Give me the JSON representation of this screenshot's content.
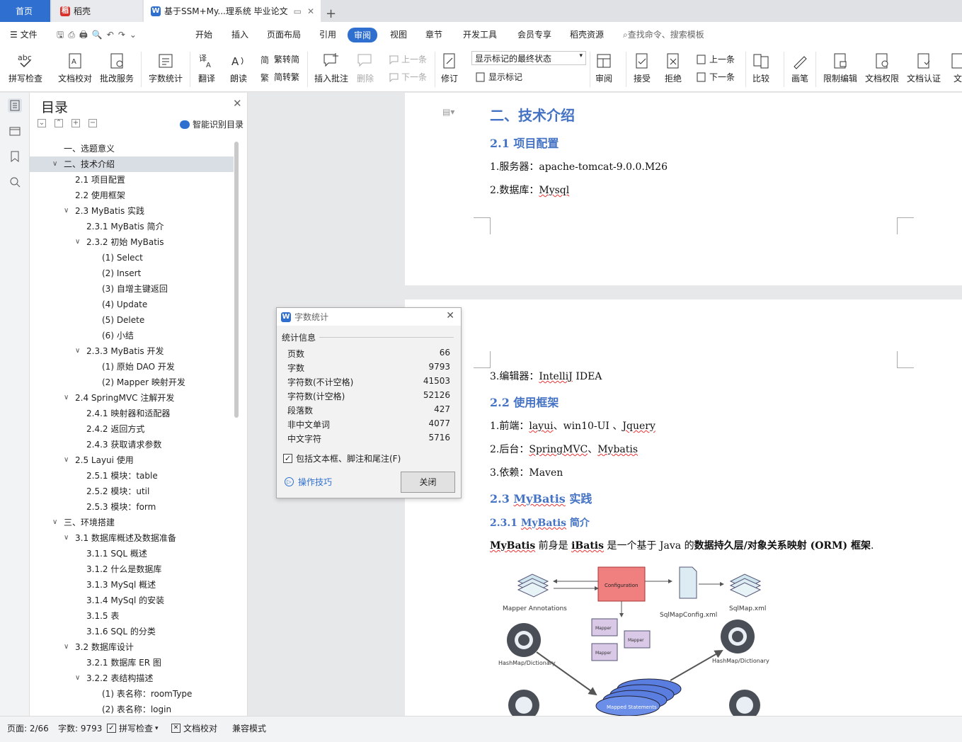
{
  "tabs": {
    "home": "首页",
    "daoke": "稻壳",
    "doc": "基于SSM+My...理系统 毕业论文"
  },
  "menu": {
    "file": "文件",
    "start": "开始",
    "insert": "插入",
    "layout": "页面布局",
    "reference": "引用",
    "review": "审阅",
    "view": "视图",
    "chapter": "章节",
    "dev": "开发工具",
    "member": "会员专享",
    "daoke_res": "稻壳资源",
    "search": "查找命令、搜索模板"
  },
  "ribbon": {
    "spell": "拼写检查",
    "proof": "文档校对",
    "correct": "批改服务",
    "wordcount": "字数统计",
    "translate": "翻译",
    "read": "朗读",
    "to_trad": "繁转简",
    "to_simp": "简转繁",
    "add_comment": "插入批注",
    "delete": "删除",
    "prev": "上一条",
    "next": "下一条",
    "track": "修订",
    "markup_state": "显示标记的最终状态",
    "show_markup": "显示标记",
    "review_pane": "审阅",
    "accept": "接受",
    "reject": "拒绝",
    "prev2": "上一条",
    "next2": "下一条",
    "compare": "比较",
    "pen": "画笔",
    "restrict": "限制编辑",
    "perm": "文档权限",
    "cert": "文档认证",
    "more": "文"
  },
  "toc": {
    "title": "目录",
    "smart": "智能识别目录",
    "items": [
      {
        "text": "一、选题意义",
        "level": 1,
        "arrow": ""
      },
      {
        "text": "二、技术介绍",
        "level": 1,
        "arrow": "v",
        "selected": true
      },
      {
        "text": "2.1 项目配置",
        "level": 2,
        "arrow": ""
      },
      {
        "text": "2.2 使用框架",
        "level": 2,
        "arrow": ""
      },
      {
        "text": "2.3 MyBatis 实践",
        "level": 2,
        "arrow": "v"
      },
      {
        "text": "2.3.1 MyBatis 简介",
        "level": 3,
        "arrow": ""
      },
      {
        "text": "2.3.2 初始 MyBatis",
        "level": 3,
        "arrow": "v"
      },
      {
        "text": "(1)  Select",
        "level": 4,
        "arrow": ""
      },
      {
        "text": "(2)  Insert",
        "level": 4,
        "arrow": ""
      },
      {
        "text": "(3)  自增主键返回",
        "level": 4,
        "arrow": ""
      },
      {
        "text": "(4)  Update",
        "level": 4,
        "arrow": ""
      },
      {
        "text": "(5)  Delete",
        "level": 4,
        "arrow": ""
      },
      {
        "text": "(6)  小结",
        "level": 4,
        "arrow": ""
      },
      {
        "text": "2.3.3 MyBatis 开发",
        "level": 3,
        "arrow": "v"
      },
      {
        "text": "(1)  原始 DAO 开发",
        "level": 4,
        "arrow": ""
      },
      {
        "text": "(2)  Mapper 映射开发",
        "level": 4,
        "arrow": ""
      },
      {
        "text": "2.4 SpringMVC 注解开发",
        "level": 2,
        "arrow": "v"
      },
      {
        "text": "2.4.1 映射器和适配器",
        "level": 3,
        "arrow": ""
      },
      {
        "text": "2.4.2 返回方式",
        "level": 3,
        "arrow": ""
      },
      {
        "text": "2.4.3 获取请求参数",
        "level": 3,
        "arrow": ""
      },
      {
        "text": "2.5 Layui 使用",
        "level": 2,
        "arrow": "v"
      },
      {
        "text": "2.5.1 模块：table",
        "level": 3,
        "arrow": ""
      },
      {
        "text": "2.5.2 模块：util",
        "level": 3,
        "arrow": ""
      },
      {
        "text": "2.5.3 模块：form",
        "level": 3,
        "arrow": ""
      },
      {
        "text": "三、环境搭建",
        "level": 1,
        "arrow": "v"
      },
      {
        "text": "3.1 数据库概述及数据准备",
        "level": 2,
        "arrow": "v"
      },
      {
        "text": "3.1.1 SQL 概述",
        "level": 3,
        "arrow": ""
      },
      {
        "text": "3.1.2 什么是数据库",
        "level": 3,
        "arrow": ""
      },
      {
        "text": "3.1.3 MySql 概述",
        "level": 3,
        "arrow": ""
      },
      {
        "text": "3.1.4 MySql 的安装",
        "level": 3,
        "arrow": ""
      },
      {
        "text": "3.1.5 表",
        "level": 3,
        "arrow": ""
      },
      {
        "text": "3.1.6 SQL 的分类",
        "level": 3,
        "arrow": ""
      },
      {
        "text": "3.2 数据库设计",
        "level": 2,
        "arrow": "v"
      },
      {
        "text": "3.2.1 数据库 ER 图",
        "level": 3,
        "arrow": ""
      },
      {
        "text": "3.2.2 表结构描述",
        "level": 3,
        "arrow": "v"
      },
      {
        "text": "(1)  表名称：roomType",
        "level": 4,
        "arrow": ""
      },
      {
        "text": "(2)  表名称：login",
        "level": 4,
        "arrow": ""
      }
    ]
  },
  "doc": {
    "h_tech": "二、技术介绍",
    "h_21": "2.1 项目配置",
    "server_label": "1.服务器：",
    "server_val": "apache-tomcat-9.0.0.M26",
    "db_label": "2.数据库：",
    "db_val": "Mysql",
    "editor_label": "3.编辑器：",
    "editor_val": "IntelliJ",
    "editor_val2": " IDEA",
    "h_22": "2.2 使用框架",
    "front_label": "1.前端：",
    "front_val1": "layui",
    "front_sep1": "、win10-UI 、",
    "front_val2": "Jquery",
    "back_label": "2.后台：",
    "back_val1": "SpringMVC",
    "back_sep": "、",
    "back_val2": "Mybatis",
    "dep_label": "3.依赖：",
    "dep_val": "Maven",
    "h_23a": "2.3 ",
    "h_23b": "MyBatis",
    "h_23c": " 实践",
    "h_231a": "2.3.1 ",
    "h_231b": "MyBatis",
    "h_231c": " 简介",
    "intro_a": "MyBatis",
    "intro_b": " 前身是 ",
    "intro_c": "iBatis",
    "intro_d": " 是一个基于 Java 的",
    "intro_e": "数据持久层/对象关系映射 (ORM) 框架",
    "intro_f": ".",
    "fig": {
      "configuration": "Configuration",
      "mapper_ann": "Mapper Annotations",
      "sqlmapconfig": "SqlMapConfig.xml",
      "sqlmap": "SqlMap.xml",
      "mapper": "Mapper",
      "hashmap": "HashMap/Dictionary",
      "mapped": "Mapped Statements"
    }
  },
  "dialog": {
    "title": "字数统计",
    "section": "统计信息",
    "rows": [
      {
        "label": "页数",
        "value": "66"
      },
      {
        "label": "字数",
        "value": "9793"
      },
      {
        "label": "字符数(不计空格)",
        "value": "41503"
      },
      {
        "label": "字符数(计空格)",
        "value": "52126"
      },
      {
        "label": "段落数",
        "value": "427"
      },
      {
        "label": "非中文单词",
        "value": "4077"
      },
      {
        "label": "中文字符",
        "value": "5716"
      }
    ],
    "include": "包括文本框、脚注和尾注(F)",
    "tips": "操作技巧",
    "close": "关闭"
  },
  "status": {
    "page": "页面: 2/66",
    "words": "字数: 9793",
    "spell": "拼写检查",
    "proof": "文档校对",
    "compat": "兼容模式"
  },
  "colors": {
    "accent": "#2f6fd0",
    "heading": "#4472c4",
    "config_box": "#f08080"
  }
}
